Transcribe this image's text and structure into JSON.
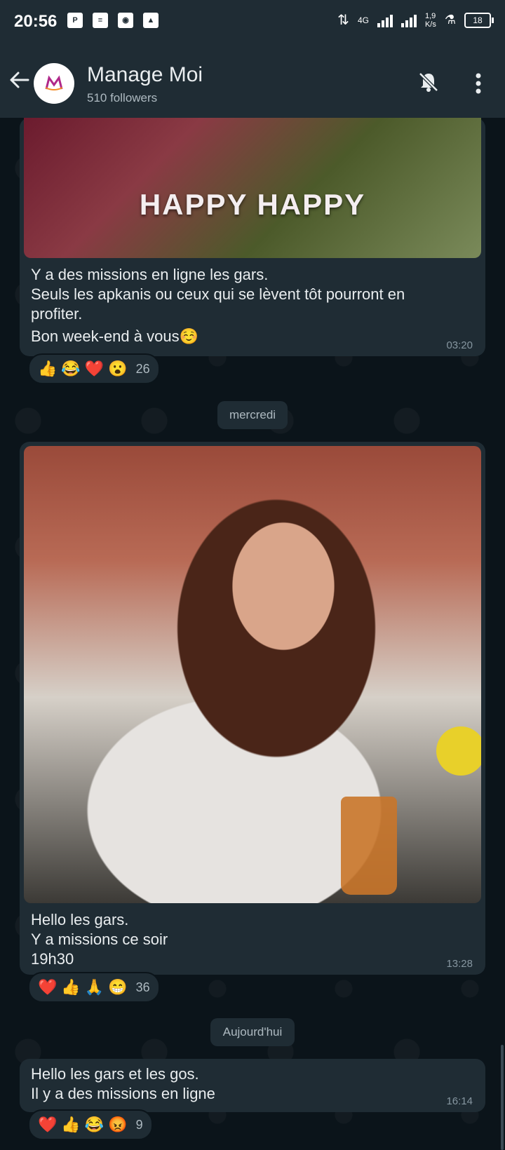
{
  "status_bar": {
    "time": "20:56",
    "network": "4G",
    "speed": "1,9\nK/s",
    "battery": "18"
  },
  "header": {
    "channel_name": "Manage Moi",
    "followers": "510 followers"
  },
  "messages": [
    {
      "gif_text": "HAPPY HAPPY",
      "lines": [
        "Y a des missions en ligne les gars.",
        "Seuls les apkanis ou ceux qui se lèvent tôt pourront en",
        "profiter.",
        "Bon week-end à vous☺️"
      ],
      "time": "03:20",
      "reactions": [
        "👍",
        "😂",
        "❤️",
        "😮"
      ],
      "reaction_count": "26"
    },
    {
      "date_chip": "mercredi",
      "lines": [
        "Hello les gars.",
        "Y a missions ce soir",
        "19h30"
      ],
      "time": "13:28",
      "reactions": [
        "❤️",
        "👍",
        "🙏",
        "😁"
      ],
      "reaction_count": "36"
    },
    {
      "date_chip": "Aujourd'hui",
      "lines": [
        "Hello les gars et les gos.",
        "Il y a des missions en ligne"
      ],
      "time": "16:14",
      "reactions": [
        "❤️",
        "👍",
        "😂",
        "😡"
      ],
      "reaction_count": "9"
    }
  ],
  "colors": {
    "background": "#0b141a",
    "bubble": "#1f2c34",
    "text": "#e9edef",
    "meta": "#8696a0"
  }
}
